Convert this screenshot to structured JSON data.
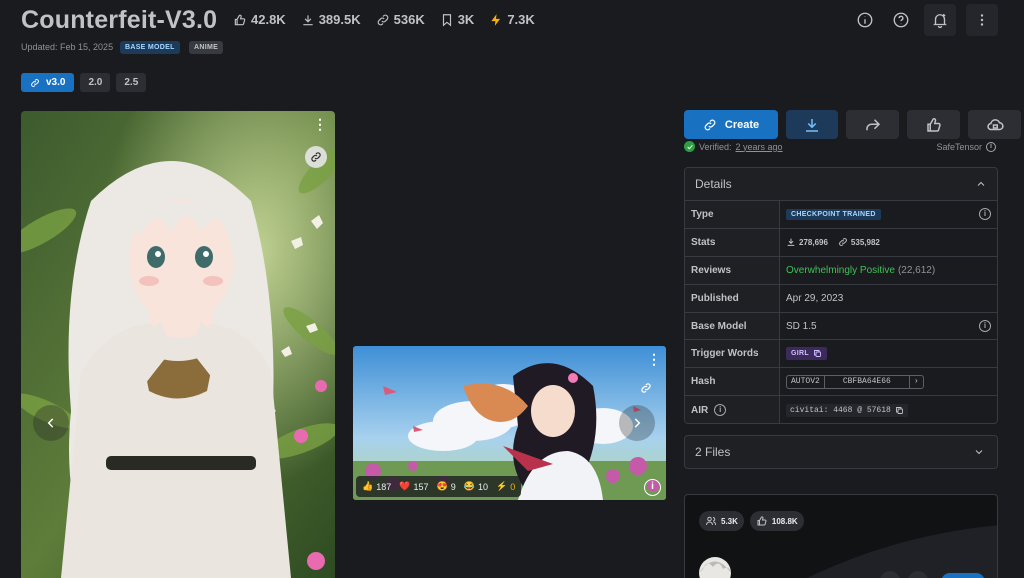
{
  "model": {
    "title": "Counterfeit-V3.0",
    "stats": [
      {
        "icon": "thumbs-up-icon",
        "value": "42.8K"
      },
      {
        "icon": "download-icon",
        "value": "389.5K"
      },
      {
        "icon": "link-icon",
        "value": "536K"
      },
      {
        "icon": "bookmark-icon",
        "value": "3K"
      },
      {
        "icon": "bolt-icon",
        "value": "7.3K"
      }
    ],
    "updated": "Updated: Feb 15, 2025",
    "tags": [
      "BASE MODEL",
      "ANIME"
    ]
  },
  "versions": [
    {
      "label": "v3.0",
      "active": true
    },
    {
      "label": "2.0",
      "active": false
    },
    {
      "label": "2.5",
      "active": false
    }
  ],
  "gallery": {
    "reactions": [
      {
        "emoji": "👍",
        "count": "187"
      },
      {
        "emoji": "❤️",
        "count": "157"
      },
      {
        "emoji": "😍",
        "count": "9"
      },
      {
        "emoji": "😂",
        "count": "10"
      },
      {
        "emoji": "⚡",
        "count": "0"
      }
    ]
  },
  "actions": {
    "create_label": "Create"
  },
  "verified": {
    "prefix": "Verified:",
    "when": "2 years ago",
    "format": "SafeTensor"
  },
  "details": {
    "heading": "Details",
    "rows": {
      "type_label": "Type",
      "type_value": "CHECKPOINT TRAINED",
      "stats_label": "Stats",
      "stats_downloads": "278,696",
      "stats_links": "535,982",
      "reviews_label": "Reviews",
      "reviews_value": "Overwhelmingly Positive",
      "reviews_count": "(22,612)",
      "published_label": "Published",
      "published_value": "Apr 29, 2023",
      "base_label": "Base Model",
      "base_value": "SD 1.5",
      "trigger_label": "Trigger Words",
      "trigger_value": "GIRL",
      "hash_label": "Hash",
      "hash_type": "AUTOV2",
      "hash_value": "CBFBA64E66",
      "air_label": "AIR",
      "air_value": "civitai: 4468 @ 57618"
    }
  },
  "files": {
    "label": "2 Files"
  },
  "creator": {
    "followers": "5.3K",
    "likes": "108.8K"
  },
  "colors": {
    "background": "#1a1b1e",
    "accent": "#1971c2",
    "positive": "#40c057"
  }
}
